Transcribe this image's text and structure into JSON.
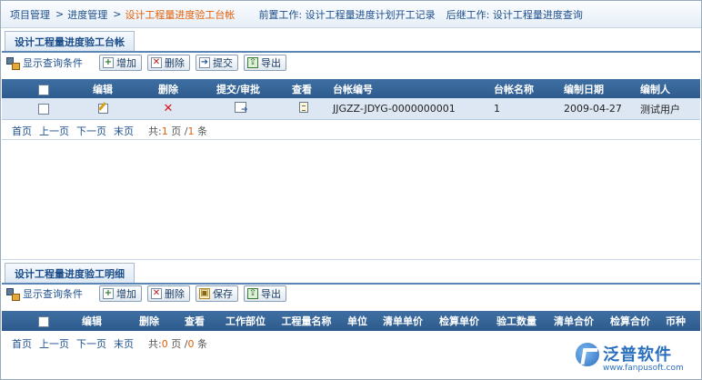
{
  "breadcrumb": {
    "items": [
      "项目管理",
      "进度管理"
    ],
    "separator": ">",
    "current": "设计工程量进度验工台帐",
    "previous_work": "前置工作: 设计工程量进度计划开工记录",
    "next_work": "后继工作: 设计工程量进度查询"
  },
  "ledger_section": {
    "tab_title": "设计工程量进度验工台帐",
    "filter_label": "显示查询条件",
    "buttons": {
      "add": "增加",
      "delete": "删除",
      "submit": "提交",
      "export": "导出"
    },
    "columns": [
      "编辑",
      "删除",
      "提交/审批",
      "查看",
      "台帐编号",
      "台帐名称",
      "编制日期",
      "编制人"
    ],
    "rows": [
      {
        "code": "JJGZZ-JDYG-0000000001",
        "name": "1",
        "date": "2009-04-27",
        "author": "测试用户"
      }
    ],
    "pager": {
      "first": "首页",
      "prev": "上一页",
      "next": "下一页",
      "last": "末页",
      "total_prefix": "共:",
      "current_page": "1",
      "page_unit": "页",
      "slash": "/",
      "total_items": "1",
      "item_unit": "条"
    }
  },
  "detail_section": {
    "tab_title": "设计工程量进度验工明细",
    "filter_label": "显示查询条件",
    "buttons": {
      "add": "增加",
      "delete": "删除",
      "save": "保存",
      "export": "导出"
    },
    "columns": [
      "编辑",
      "删除",
      "查看",
      "工作部位",
      "工程量名称",
      "单位",
      "清单单价",
      "检算单价",
      "验工数量",
      "清单合价",
      "检算合价",
      "币种"
    ],
    "pager": {
      "first": "首页",
      "prev": "上一页",
      "next": "下一页",
      "last": "末页",
      "total_prefix": "共:",
      "current_page": "0",
      "page_unit": "页",
      "slash": "/",
      "total_items": "0",
      "item_unit": "条"
    }
  },
  "logo": {
    "name": "泛普软件",
    "url": "www.fanpusoft.com"
  },
  "colors": {
    "header_blue": "#2d5a8d",
    "link_blue": "#1d4f8c",
    "accent_orange": "#e2600a",
    "row_bg": "#dce7f3"
  }
}
